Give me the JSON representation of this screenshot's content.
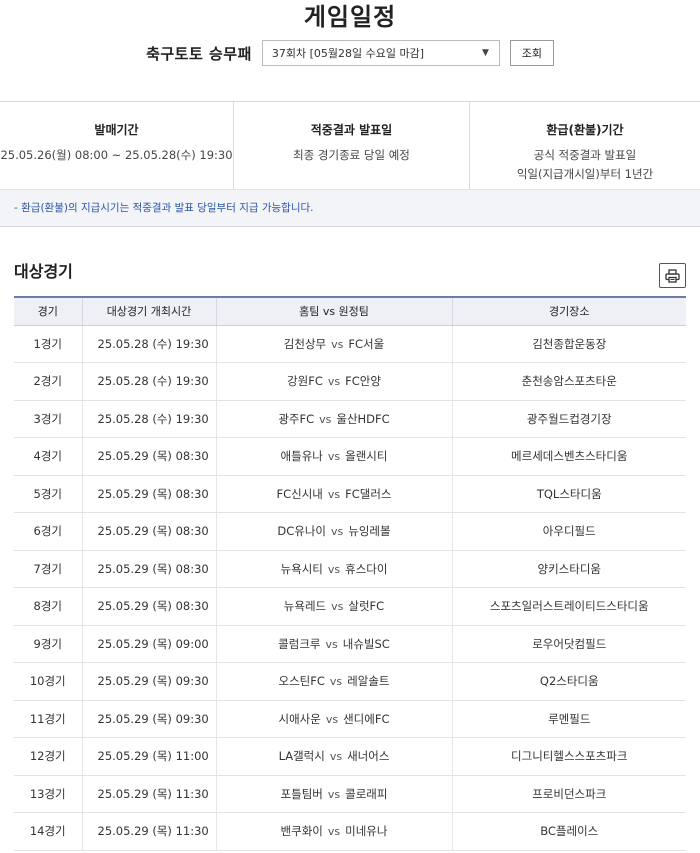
{
  "header": {
    "title": "게임일정",
    "game_name": "축구토토 승무패",
    "round_select_value": "37회차 [05월28일 수요일 마감]",
    "search_label": "조회"
  },
  "info": [
    {
      "label": "발매기간",
      "lines": [
        "25.05.26(월) 08:00 ~ 25.05.28(수) 19:30"
      ]
    },
    {
      "label": "적중결과 발표일",
      "lines": [
        "최종 경기종료 당일 예정"
      ]
    },
    {
      "label": "환급(환불)기간",
      "lines": [
        "공식 적중결과 발표일",
        "익일(지급개시일)부터 1년간"
      ]
    }
  ],
  "notice": "- 환급(환불)의 지급시기는 적중결과 발표 당일부터 지급 가능합니다.",
  "section": {
    "title": "대상경기",
    "print_icon": "printer-icon"
  },
  "table": {
    "headers": [
      "경기",
      "대상경기 개최시간",
      "홈팀 vs 원정팀",
      "경기장소"
    ],
    "vs_label": "vs",
    "rows": [
      {
        "no": "1경기",
        "time": "25.05.28 (수) 19:30",
        "home": "김천상무",
        "away": "FC서울",
        "venue": "김천종합운동장"
      },
      {
        "no": "2경기",
        "time": "25.05.28 (수) 19:30",
        "home": "강원FC",
        "away": "FC안양",
        "venue": "춘천송암스포츠타운"
      },
      {
        "no": "3경기",
        "time": "25.05.28 (수) 19:30",
        "home": "광주FC",
        "away": "울산HDFC",
        "venue": "광주월드컵경기장"
      },
      {
        "no": "4경기",
        "time": "25.05.29 (목) 08:30",
        "home": "애틀유나",
        "away": "올랜시티",
        "venue": "메르세데스벤츠스타디움"
      },
      {
        "no": "5경기",
        "time": "25.05.29 (목) 08:30",
        "home": "FC신시내",
        "away": "FC댈러스",
        "venue": "TQL스타디움"
      },
      {
        "no": "6경기",
        "time": "25.05.29 (목) 08:30",
        "home": "DC유나이",
        "away": "뉴잉레볼",
        "venue": "아우디필드"
      },
      {
        "no": "7경기",
        "time": "25.05.29 (목) 08:30",
        "home": "뉴욕시티",
        "away": "휴스다이",
        "venue": "양키스타디움"
      },
      {
        "no": "8경기",
        "time": "25.05.29 (목) 08:30",
        "home": "뉴욕레드",
        "away": "살럿FC",
        "venue": "스포츠일러스트레이티드스타디움"
      },
      {
        "no": "9경기",
        "time": "25.05.29 (목) 09:00",
        "home": "콜럼크루",
        "away": "내슈빌SC",
        "venue": "로우어닷컴필드"
      },
      {
        "no": "10경기",
        "time": "25.05.29 (목) 09:30",
        "home": "오스틴FC",
        "away": "레알솔트",
        "venue": "Q2스타디움"
      },
      {
        "no": "11경기",
        "time": "25.05.29 (목) 09:30",
        "home": "시애사운",
        "away": "샌디에FC",
        "venue": "루멘필드"
      },
      {
        "no": "12경기",
        "time": "25.05.29 (목) 11:00",
        "home": "LA갤럭시",
        "away": "새너어스",
        "venue": "디그니티헬스스포츠파크"
      },
      {
        "no": "13경기",
        "time": "25.05.29 (목) 11:30",
        "home": "포틀팀버",
        "away": "콜로래피",
        "venue": "프로비던스파크"
      },
      {
        "no": "14경기",
        "time": "25.05.29 (목) 11:30",
        "home": "밴쿠화이",
        "away": "미네유나",
        "venue": "BC플레이스"
      }
    ]
  }
}
